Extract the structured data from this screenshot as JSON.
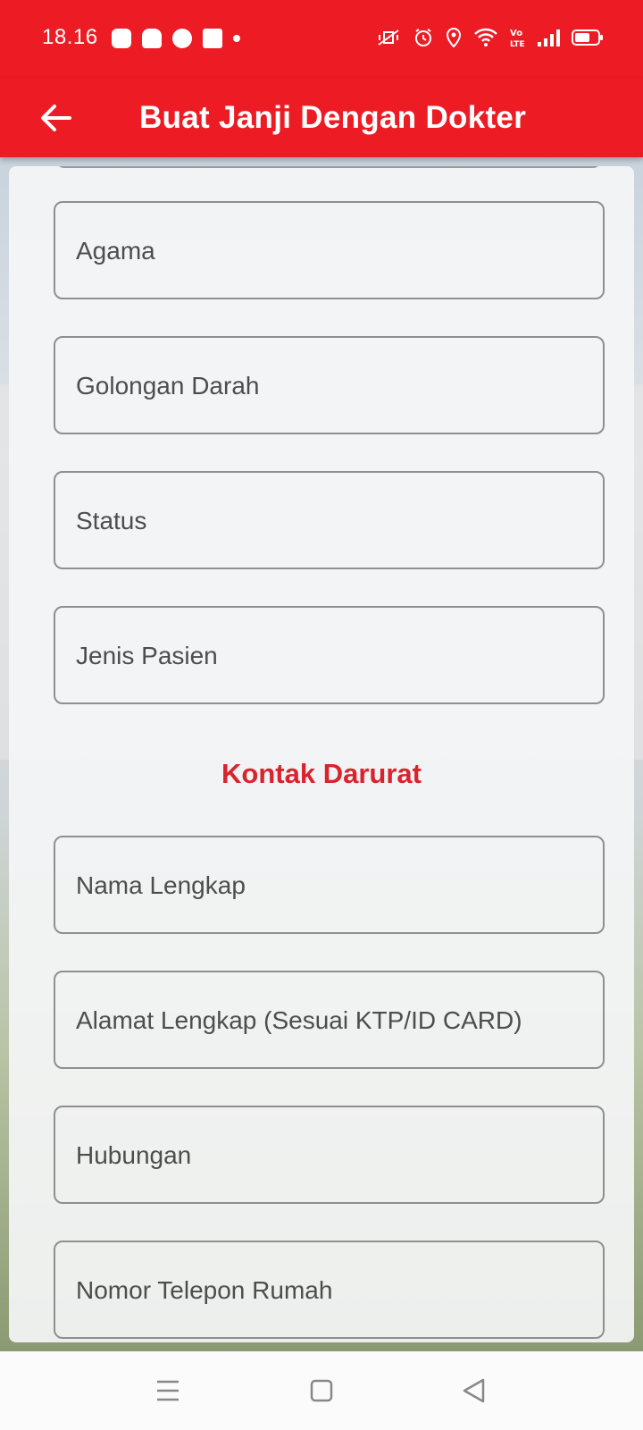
{
  "status_bar": {
    "time": "18.16",
    "left_icons": [
      "line-icon",
      "discord-icon",
      "chat-bubble-icon",
      "facebook-icon",
      "dot-icon"
    ],
    "right_icons": [
      "vibrate-mute-icon",
      "alarm-icon",
      "location-icon",
      "wifi-icon",
      "volte-icon",
      "signal-icon",
      "battery-icon"
    ]
  },
  "app_bar": {
    "title": "Buat Janji Dengan Dokter",
    "back_icon": "arrow-left-icon"
  },
  "form": {
    "fields_top": [
      {
        "placeholder": "Agama"
      },
      {
        "placeholder": "Golongan Darah"
      },
      {
        "placeholder": "Status"
      },
      {
        "placeholder": "Jenis Pasien"
      }
    ],
    "section_title": "Kontak Darurat",
    "fields_emergency": [
      {
        "placeholder": "Nama Lengkap"
      },
      {
        "placeholder": "Alamat Lengkap (Sesuai KTP/ID CARD)"
      },
      {
        "placeholder": "Hubungan"
      },
      {
        "placeholder": "Nomor Telepon Rumah"
      }
    ]
  },
  "nav_bar": {
    "items": [
      "menu-icon",
      "home-square-icon",
      "back-triangle-icon"
    ]
  },
  "colors": {
    "primary": "#ED1C24",
    "section_title": "#D9232D",
    "field_border": "#8f8f8f",
    "placeholder": "#4d4d4d"
  }
}
